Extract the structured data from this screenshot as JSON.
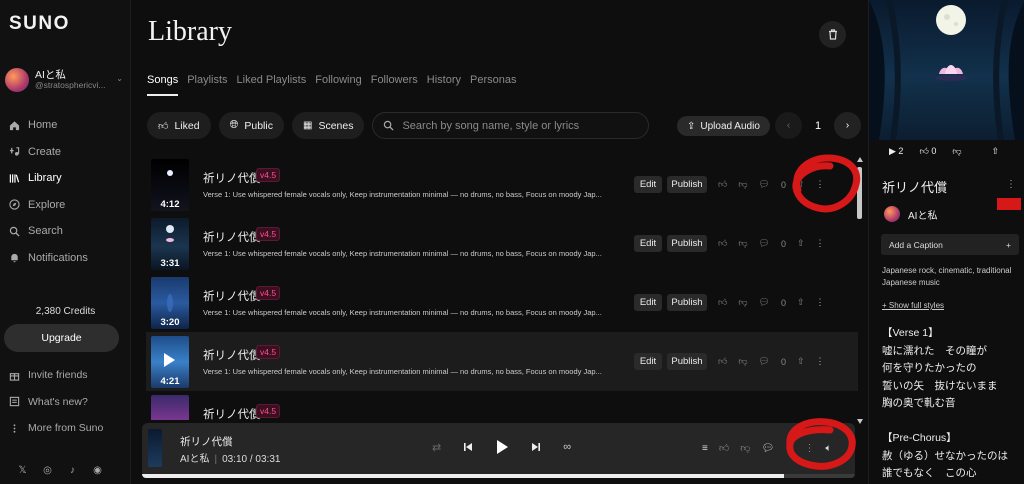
{
  "app": {
    "logo": "SUNO"
  },
  "user": {
    "name": "AIと私",
    "handle": "@stratosphericvi..."
  },
  "nav": [
    {
      "label": "Home",
      "icon": "home-icon"
    },
    {
      "label": "Create",
      "icon": "create-icon"
    },
    {
      "label": "Library",
      "icon": "library-icon",
      "active": true
    },
    {
      "label": "Explore",
      "icon": "explore-icon"
    },
    {
      "label": "Search",
      "icon": "search-icon"
    },
    {
      "label": "Notifications",
      "icon": "bell-icon"
    }
  ],
  "credits": "2,380 Credits",
  "upgrade_label": "Upgrade",
  "nav2": [
    {
      "label": "Invite friends",
      "icon": "gift-icon"
    },
    {
      "label": "What's new?",
      "icon": "news-icon"
    },
    {
      "label": "More from Suno",
      "icon": "more-icon"
    }
  ],
  "page": {
    "title": "Library"
  },
  "tabs": [
    "Songs",
    "Playlists",
    "Liked Playlists",
    "Following",
    "Followers",
    "History",
    "Personas"
  ],
  "filters": {
    "liked": "Liked",
    "public": "Public",
    "scenes": "Scenes"
  },
  "search": {
    "placeholder": "Search by song name, style or lyrics"
  },
  "upload_label": "Upload Audio",
  "pager": {
    "page": "1"
  },
  "songs": [
    {
      "title": "祈リノ代償",
      "version": "v4.5",
      "duration": "4:12",
      "desc": "Verse 1: Use whispered female vocals only, Keep instrumentation minimal — no drums, no bass, Focus on moody Jap...",
      "edit": "Edit",
      "publish": "Publish",
      "comments": "0"
    },
    {
      "title": "祈リノ代償",
      "version": "v4.5",
      "duration": "3:31",
      "desc": "Verse 1: Use whispered female vocals only, Keep instrumentation minimal — no drums, no bass, Focus on moody Jap...",
      "edit": "Edit",
      "publish": "Publish",
      "comments": "0"
    },
    {
      "title": "祈リノ代償",
      "version": "v4.5",
      "duration": "3:20",
      "desc": "Verse 1: Use whispered female vocals only, Keep instrumentation minimal — no drums, no bass, Focus on moody Jap...",
      "edit": "Edit",
      "publish": "Publish",
      "comments": "0"
    },
    {
      "title": "祈リノ代償",
      "version": "v4.5",
      "duration": "4:21",
      "desc": "Verse 1: Use whispered female vocals only, Keep instrumentation minimal — no drums, no bass, Focus on moody Jap...",
      "edit": "Edit",
      "publish": "Publish",
      "comments": "0"
    },
    {
      "title": "祈リノ代償",
      "version": "v4.5",
      "duration": "",
      "desc": "",
      "edit": "",
      "publish": "",
      "comments": ""
    }
  ],
  "player": {
    "title": "祈リノ代償",
    "artist": "AIと私",
    "time": "03:10 / 03:31",
    "progress": 0.9
  },
  "panel": {
    "plays": "2",
    "likes": "0",
    "title": "祈リノ代償",
    "artist": "AIと私",
    "caption": "Add a Caption",
    "styles": "Japanese rock, cinematic, traditional Japanese music",
    "show_all": "+ Show full styles",
    "lyrics": "【Verse 1】\n嘘に濡れた　その瞳が\n何を守りたかったの\n誓いの矢　抜けないまま\n胸の奥で軋む音\n\n【Pre-Chorus】\n赦（ゆる）せなかったのは\n誰でもなく　この心\nだけど　まだ消せずに"
  },
  "colors": {
    "annotation": "#d61818",
    "badge": "#ff4d8f",
    "background": "#0e0e0e"
  }
}
